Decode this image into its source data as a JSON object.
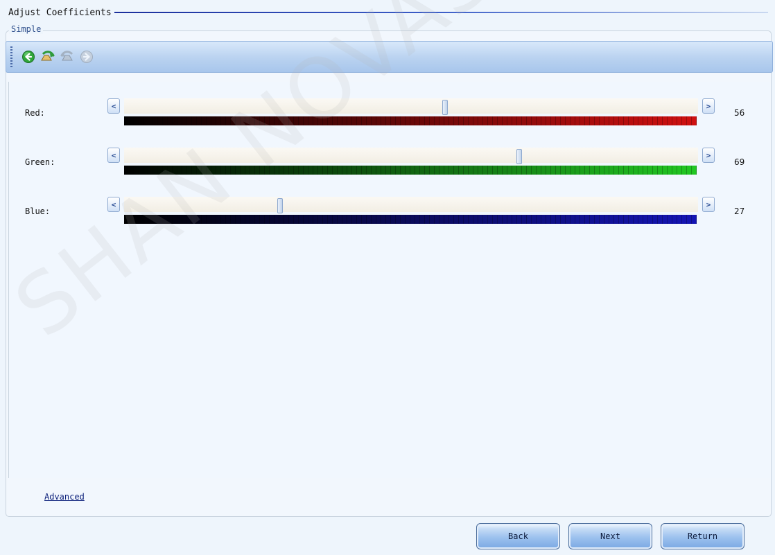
{
  "window": {
    "title": "Adjust Coefficients"
  },
  "group": {
    "label": "Simple"
  },
  "toolbar": {
    "buttons": [
      {
        "icon": "back-arrow-icon",
        "enabled": true
      },
      {
        "icon": "undo-icon",
        "enabled": true
      },
      {
        "icon": "redo-icon",
        "enabled": false
      },
      {
        "icon": "forward-arrow-icon",
        "enabled": false
      }
    ]
  },
  "sliders": [
    {
      "label": "Red:",
      "value": "56",
      "fraction": 0.56,
      "color": "#d01010"
    },
    {
      "label": "Green:",
      "value": "69",
      "fraction": 0.69,
      "color": "#22c822"
    },
    {
      "label": "Blue:",
      "value": "27",
      "fraction": 0.27,
      "color": "#1414b4"
    }
  ],
  "links": {
    "advanced": "Advanced"
  },
  "buttons": {
    "back": "Back",
    "next": "Next",
    "return": "Return"
  },
  "watermark": {
    "text": "SHAN NOVASTAR TECH CO., L"
  },
  "colors": {
    "title_line": "#1b2f9c",
    "toolbar": "#b9d2f0",
    "panel_bg": "#f1f7fe"
  }
}
